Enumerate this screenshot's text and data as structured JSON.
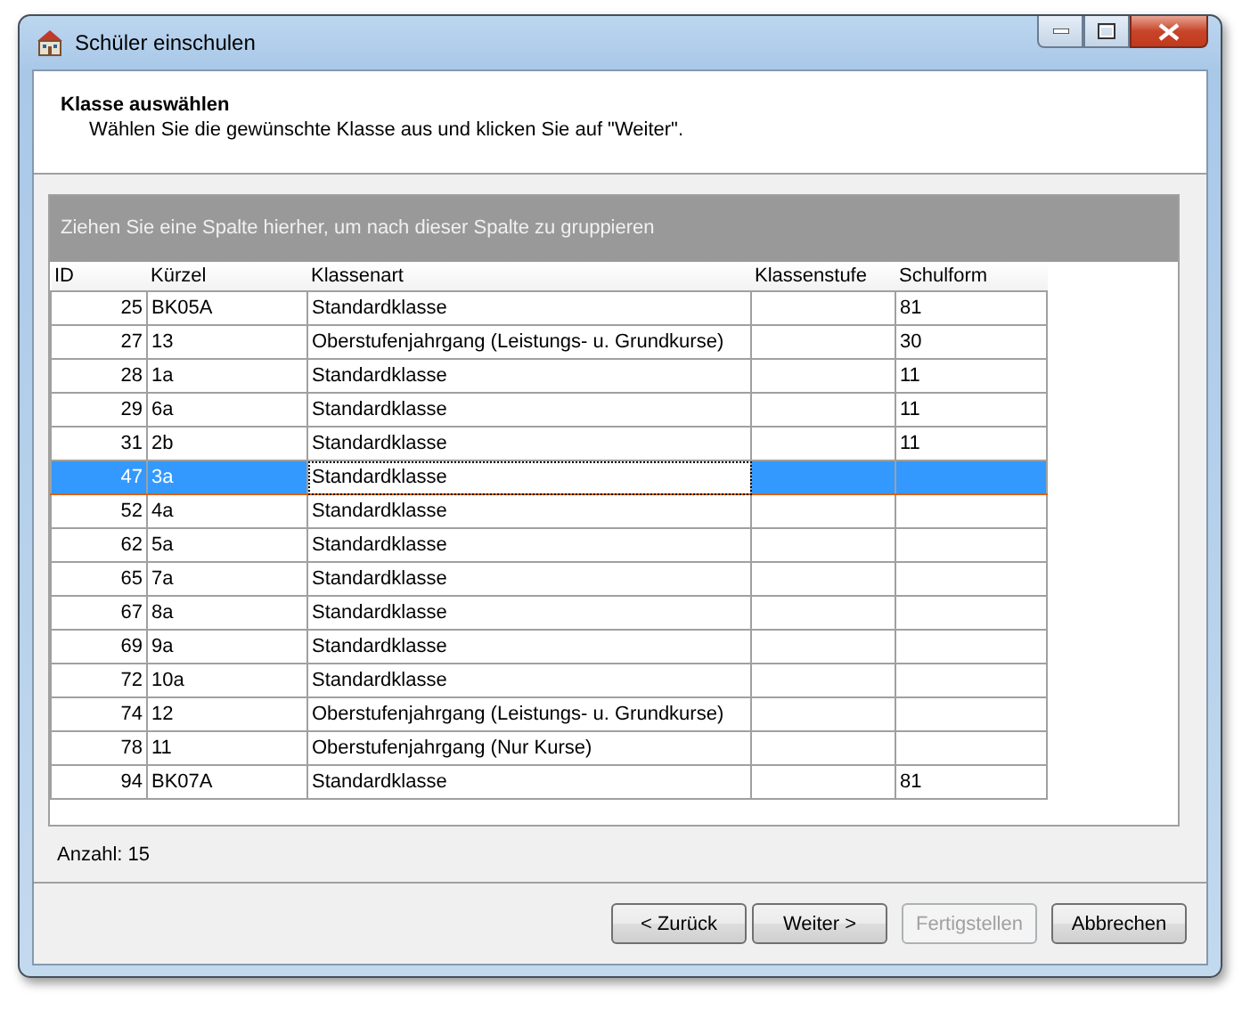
{
  "window": {
    "title": "Schüler einschulen"
  },
  "header": {
    "title": "Klasse auswählen",
    "subtitle": "Wählen Sie die gewünschte Klasse aus und klicken Sie auf \"Weiter\"."
  },
  "group_panel": {
    "hint": "Ziehen Sie eine Spalte hierher, um nach dieser Spalte zu gruppieren"
  },
  "table": {
    "columns": [
      {
        "label": "ID",
        "focused": false
      },
      {
        "label": "Kürzel",
        "focused": false
      },
      {
        "label": "Klassenart",
        "focused": true
      },
      {
        "label": "Klassenstufe",
        "focused": false
      },
      {
        "label": "Schulform",
        "focused": false
      }
    ],
    "rows": [
      {
        "cells": [
          "25",
          "BK05A",
          "Standardklasse",
          "",
          "81"
        ],
        "selected": false
      },
      {
        "cells": [
          "27",
          "13",
          "Oberstufenjahrgang (Leistungs- u. Grundkurse)",
          "",
          "30"
        ],
        "selected": false
      },
      {
        "cells": [
          "28",
          "1a",
          "Standardklasse",
          "",
          "11"
        ],
        "selected": false
      },
      {
        "cells": [
          "29",
          "6a",
          "Standardklasse",
          "",
          "11"
        ],
        "selected": false
      },
      {
        "cells": [
          "31",
          "2b",
          "Standardklasse",
          "",
          "11"
        ],
        "selected": false
      },
      {
        "cells": [
          "47",
          "3a",
          "Standardklasse",
          "",
          ""
        ],
        "selected": true
      },
      {
        "cells": [
          "52",
          "4a",
          "Standardklasse",
          "",
          ""
        ],
        "selected": false
      },
      {
        "cells": [
          "62",
          "5a",
          "Standardklasse",
          "",
          ""
        ],
        "selected": false
      },
      {
        "cells": [
          "65",
          "7a",
          "Standardklasse",
          "",
          ""
        ],
        "selected": false
      },
      {
        "cells": [
          "67",
          "8a",
          "Standardklasse",
          "",
          ""
        ],
        "selected": false
      },
      {
        "cells": [
          "69",
          "9a",
          "Standardklasse",
          "",
          ""
        ],
        "selected": false
      },
      {
        "cells": [
          "72",
          "10a",
          "Standardklasse",
          "",
          ""
        ],
        "selected": false
      },
      {
        "cells": [
          "74",
          "12",
          "Oberstufenjahrgang (Leistungs- u. Grundkurse)",
          "",
          ""
        ],
        "selected": false
      },
      {
        "cells": [
          "78",
          "11",
          "Oberstufenjahrgang (Nur Kurse)",
          "",
          ""
        ],
        "selected": false
      },
      {
        "cells": [
          "94",
          "BK07A",
          "Standardklasse",
          "",
          "81"
        ],
        "selected": false
      }
    ]
  },
  "count": "Anzahl: 15",
  "buttons": [
    {
      "label": "< Zurück",
      "disabled": false
    },
    {
      "label": "Weiter >",
      "disabled": false
    },
    {
      "label": "Fertigstellen",
      "disabled": true
    },
    {
      "label": "Abbrechen",
      "disabled": false
    }
  ]
}
